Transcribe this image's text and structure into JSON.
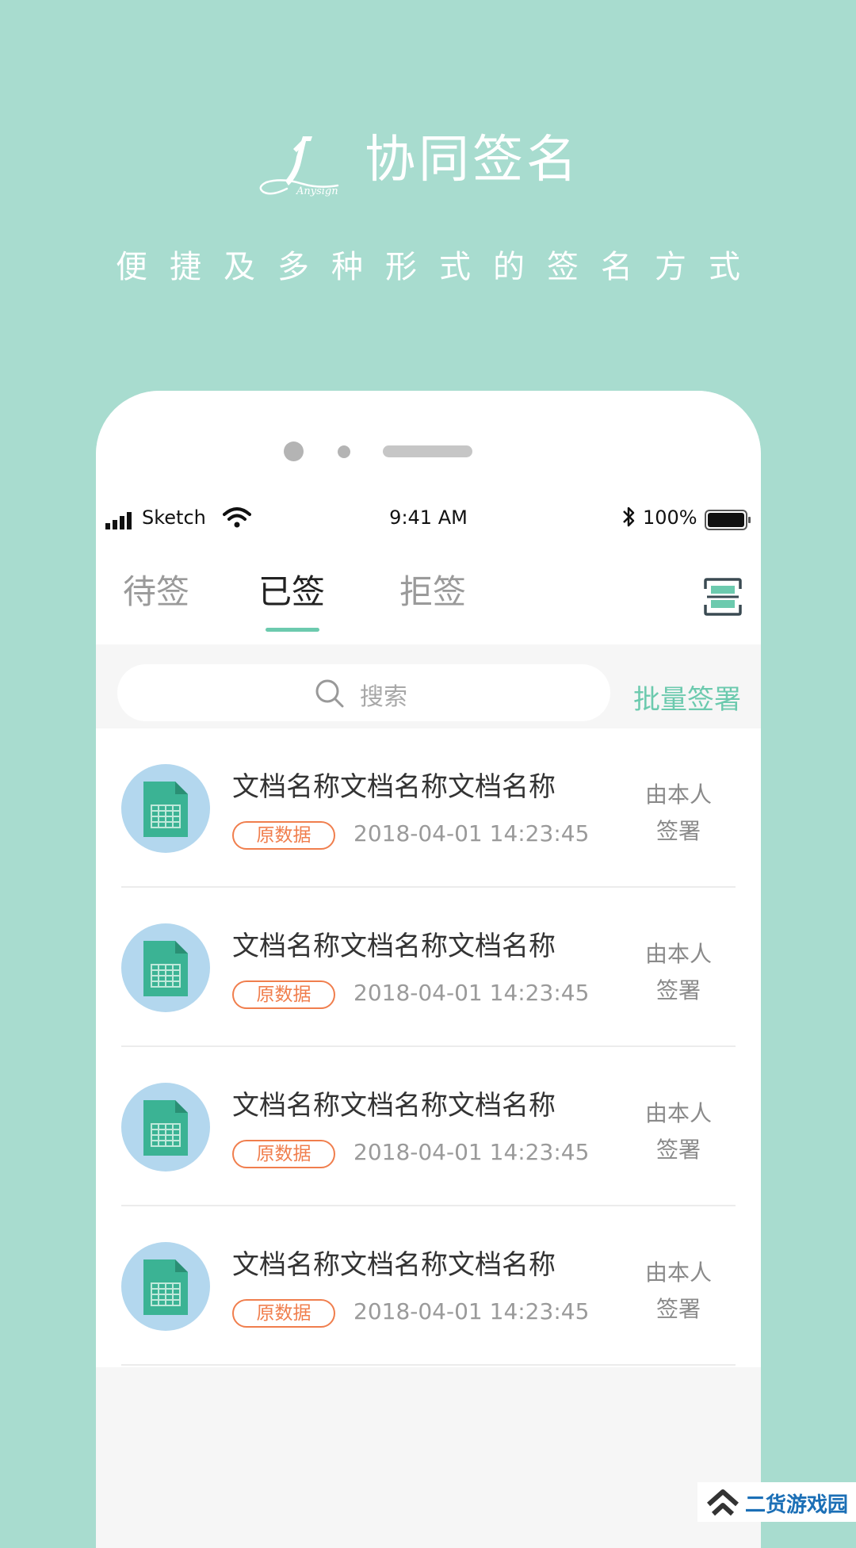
{
  "hero": {
    "logo_text": "Anysign",
    "title": "协同签名",
    "subtitle": "便捷及多种形式的签名方式"
  },
  "status_bar": {
    "carrier": "Sketch",
    "time": "9:41 AM",
    "battery": "100%"
  },
  "tabs": [
    {
      "label": "待签",
      "active": false
    },
    {
      "label": "已签",
      "active": true
    },
    {
      "label": "拒签",
      "active": false
    }
  ],
  "search": {
    "placeholder": "搜索",
    "batch_label": "批量签署"
  },
  "documents": [
    {
      "title": "文档名称文档名称文档名称",
      "tag": "原数据",
      "date": "2018-04-01 14:23:45",
      "status_line1": "由本人",
      "status_line2": "签署"
    },
    {
      "title": "文档名称文档名称文档名称",
      "tag": "原数据",
      "date": "2018-04-01 14:23:45",
      "status_line1": "由本人",
      "status_line2": "签署"
    },
    {
      "title": "文档名称文档名称文档名称",
      "tag": "原数据",
      "date": "2018-04-01 14:23:45",
      "status_line1": "由本人",
      "status_line2": "签署"
    },
    {
      "title": "文档名称文档名称文档名称",
      "tag": "原数据",
      "date": "2018-04-01 14:23:45",
      "status_line1": "由本人",
      "status_line2": "签署"
    }
  ],
  "watermark": {
    "text": "二货游戏园"
  },
  "icons": {
    "logo": "pen-signature-icon",
    "scan": "scan-icon",
    "search": "search-icon",
    "document": "spreadsheet-document-icon"
  },
  "colors": {
    "background": "#a8dccf",
    "accent": "#6ccaae",
    "tag": "#f07e4d",
    "doc_icon_circle": "#b3d7ee",
    "doc_icon_file": "#3bb394"
  }
}
